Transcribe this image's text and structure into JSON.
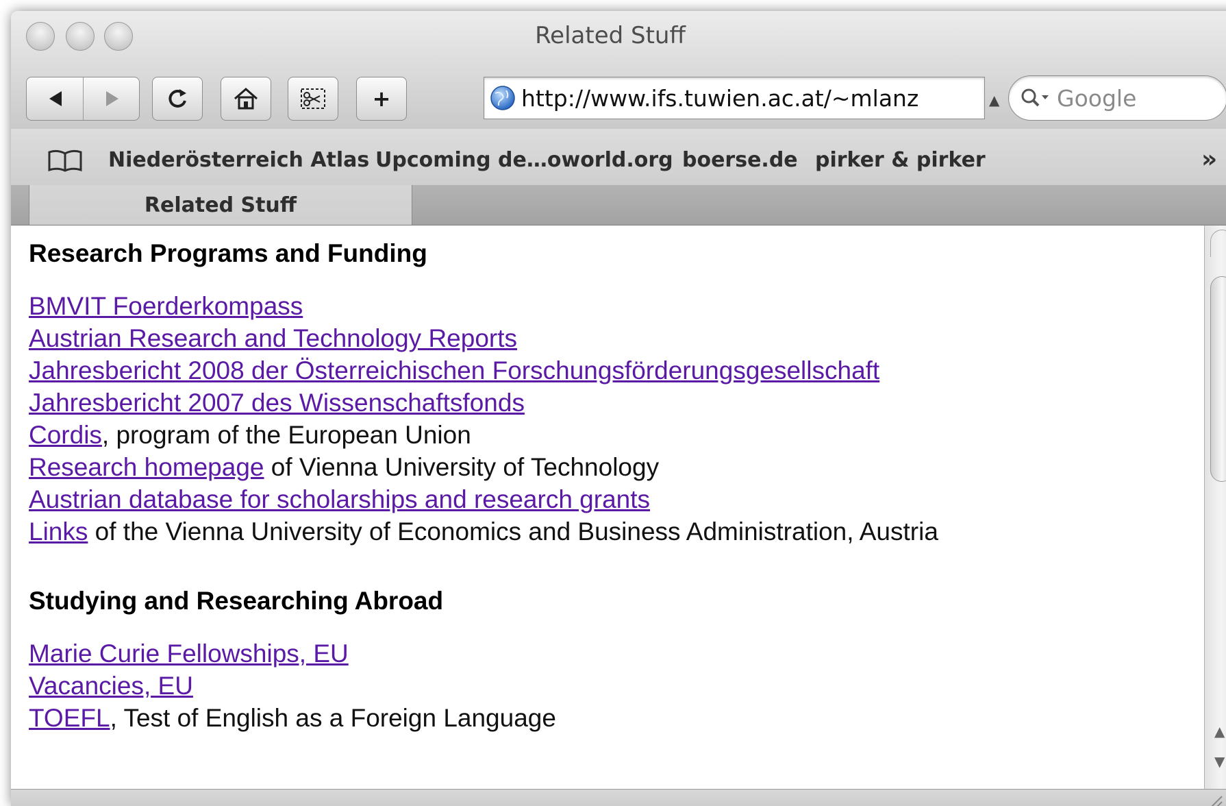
{
  "window": {
    "title": "Related Stuff"
  },
  "toolbar": {
    "back_icon": "back-arrow-icon",
    "forward_icon": "forward-arrow-icon",
    "reload_icon": "reload-icon",
    "home_icon": "home-icon",
    "snip_icon": "scissors-icon",
    "add_bookmark_label": "+",
    "url": "http://www.ifs.tuwien.ac.at/~mlanz",
    "search_placeholder": "Google"
  },
  "bookmarks": {
    "items": [
      "Niederösterreich Atlas",
      "Upcoming de…oworld.org",
      "boerse.de",
      "pirker & pirker"
    ],
    "more_label": "»"
  },
  "tabs": [
    {
      "label": "Related Stuff"
    }
  ],
  "content": {
    "sections": [
      {
        "title": "Research Programs and Funding",
        "lines": [
          {
            "link": "BMVIT Foerderkompass",
            "text": ""
          },
          {
            "link": "Austrian Research and Technology Reports",
            "text": ""
          },
          {
            "link": "Jahresbericht 2008 der Österreichischen Forschungsförderungsgesellschaft",
            "text": ""
          },
          {
            "link": "Jahresbericht 2007 des Wissenschaftsfonds",
            "text": ""
          },
          {
            "link": "Cordis",
            "text": ", program of the European Union"
          },
          {
            "link": "Research homepage",
            "text": " of Vienna University of Technology"
          },
          {
            "link": "Austrian database for scholarships and research grants",
            "text": ""
          },
          {
            "link": "Links",
            "text": " of the Vienna University of Economics and Business Administration, Austria"
          }
        ]
      },
      {
        "title": "Studying and Researching Abroad",
        "lines": [
          {
            "link": "Marie Curie Fellowships, EU",
            "text": ""
          },
          {
            "link": "Vacancies, EU",
            "text": ""
          },
          {
            "link": "TOEFL",
            "text": ", Test of English as a Foreign Language"
          }
        ]
      }
    ]
  },
  "colors": {
    "link": "#5a1aa5",
    "chrome": "#d9d9d9"
  }
}
